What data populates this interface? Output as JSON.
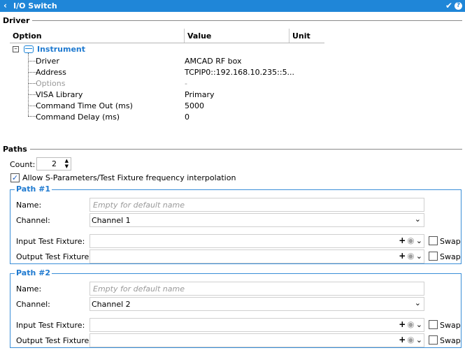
{
  "titlebar": {
    "title": "I/O Switch"
  },
  "driver": {
    "section_title": "Driver",
    "columns": [
      "Option",
      "Value",
      "Unit"
    ],
    "root_label": "Instrument",
    "rows": [
      {
        "option": "Driver",
        "value": "AMCAD RF box"
      },
      {
        "option": "Address",
        "value": "TCPIP0::192.168.10.235::5..."
      },
      {
        "option": "Options",
        "value": "-"
      },
      {
        "option": "VISA Library",
        "value": "Primary"
      },
      {
        "option": "Command Time Out (ms)",
        "value": "5000"
      },
      {
        "option": "Command Delay (ms)",
        "value": "0"
      }
    ]
  },
  "paths": {
    "section_title": "Paths",
    "count_label": "Count:",
    "count_value": "2",
    "interpolation_label": "Allow S-Parameters/Test Fixture frequency interpolation",
    "interpolation_checked": true,
    "groups": [
      {
        "title": "Path #1",
        "name_label": "Name:",
        "name_placeholder": "Empty for default name",
        "channel_label": "Channel:",
        "channel_value": "Channel 1",
        "input_label": "Input Test Fixture:",
        "output_label": "Output Test Fixture:",
        "swap_label": "Swap"
      },
      {
        "title": "Path #2",
        "name_label": "Name:",
        "name_placeholder": "Empty for default name",
        "channel_label": "Channel:",
        "channel_value": "Channel 2",
        "input_label": "Input Test Fixture:",
        "output_label": "Output Test Fixture:",
        "swap_label": "Swap"
      }
    ]
  },
  "icons": {
    "back": "back-chevron-icon",
    "apply": "checkmark-icon",
    "help": "help-icon",
    "instrument": "instrument-icon",
    "add": "plus-icon",
    "view": "eye-icon",
    "dropdown": "chevron-down-icon"
  },
  "colors": {
    "accent": "#1f86d8",
    "group_border": "#3a8fd8",
    "group_title": "#1f7ad0"
  }
}
